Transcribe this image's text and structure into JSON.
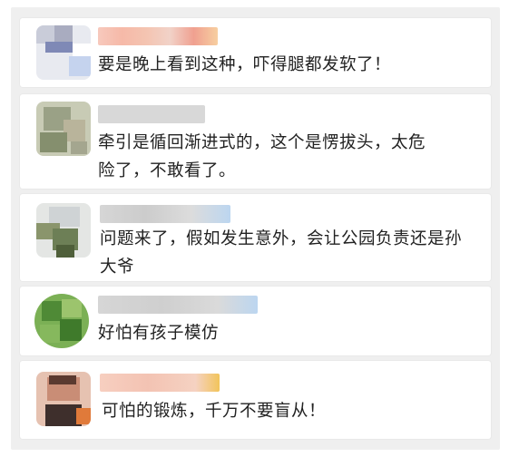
{
  "comments": [
    {
      "text": "要是晚上看到这种，吓得腿都发软了！",
      "avatar_colors": [
        "#c9ccd9",
        "#a9acc0",
        "#7f89b6",
        "#e8eaf0",
        "#ffffff",
        "#c5d3ee"
      ],
      "name_colors": [
        "#f7c9bd",
        "#f6b9a8",
        "#f4c4b1",
        "#f1d2c8",
        "#f0a090",
        "#f7cfa0"
      ]
    },
    {
      "text": "牵引是循回渐进式的，这个是愣拔头，太危\n险了，不敢看了。",
      "avatar_colors": [
        "#c8cbb5",
        "#9aa186",
        "#b9b49b",
        "#858f6e",
        "#d6d2c2",
        "#a4a68f"
      ],
      "name_colors": [
        "#d7d7d7",
        "#cfcfcf",
        "#dcdcdc",
        "#d3d3d3",
        "#e0e0e0",
        "#d0d0d0"
      ]
    },
    {
      "text": "问题来了，假如发生意外，会让公园负责还是孙\n大爷",
      "avatar_colors": [
        "#cfd3d5",
        "#6d7f56",
        "#e4e6e4",
        "#4f5f3a",
        "#b1b8ae",
        "#8a956c"
      ],
      "name_colors": [
        "#d9d9d9",
        "#cfcfcf",
        "#d7d7d7",
        "#cccccc",
        "#e6e6e6",
        "#bfd8f0"
      ]
    },
    {
      "text": "好怕有孩子模仿",
      "avatar_colors": [
        "#7bb055",
        "#4f8a36",
        "#9cc46d",
        "#3f7a2b",
        "#86b85d",
        "#6aa14a"
      ],
      "name_colors": [
        "#d6d6d6",
        "#cccccc",
        "#dadada",
        "#cfcfcf",
        "#dcdcdc",
        "#bcd6f0"
      ]
    },
    {
      "text": "可怕的锻炼，千万不要盲从！",
      "avatar_colors": [
        "#c98d76",
        "#5b3a30",
        "#e6c2b1",
        "#3e2f2c",
        "#d9a48e",
        "#e07a3a"
      ],
      "name_colors": [
        "#f7cfc0",
        "#f3c3b3",
        "#f5d2c2",
        "#f0c8b0",
        "#f5d9c9",
        "#f2c45a"
      ]
    }
  ]
}
